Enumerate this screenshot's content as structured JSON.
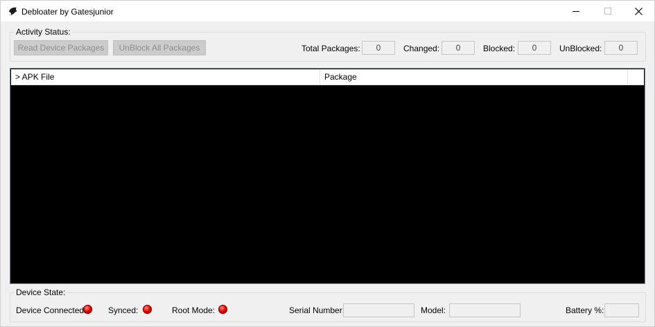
{
  "window": {
    "title": "Debloater by Gatesjunior"
  },
  "activity": {
    "legend": "Activity Status:",
    "read_button": "Read Device Packages",
    "unblock_button": "UnBlock All Packages",
    "total_label": "Total Packages:",
    "total_value": "0",
    "changed_label": "Changed:",
    "changed_value": "0",
    "blocked_label": "Blocked:",
    "blocked_value": "0",
    "unblocked_label": "UnBlocked:",
    "unblocked_value": "0"
  },
  "list": {
    "columns": [
      "> APK File",
      "Package"
    ]
  },
  "device": {
    "legend": "Device State:",
    "connected_label": "Device Connected:",
    "synced_label": "Synced:",
    "root_label": "Root Mode:",
    "serial_label": "Serial Number:",
    "serial_value": "",
    "model_label": "Model:",
    "model_value": "",
    "battery_label": "Battery %:",
    "battery_value": ""
  },
  "colors": {
    "indicator_off": "#e00000",
    "list_background": "#000000",
    "disabled_button": "#cccccc"
  }
}
